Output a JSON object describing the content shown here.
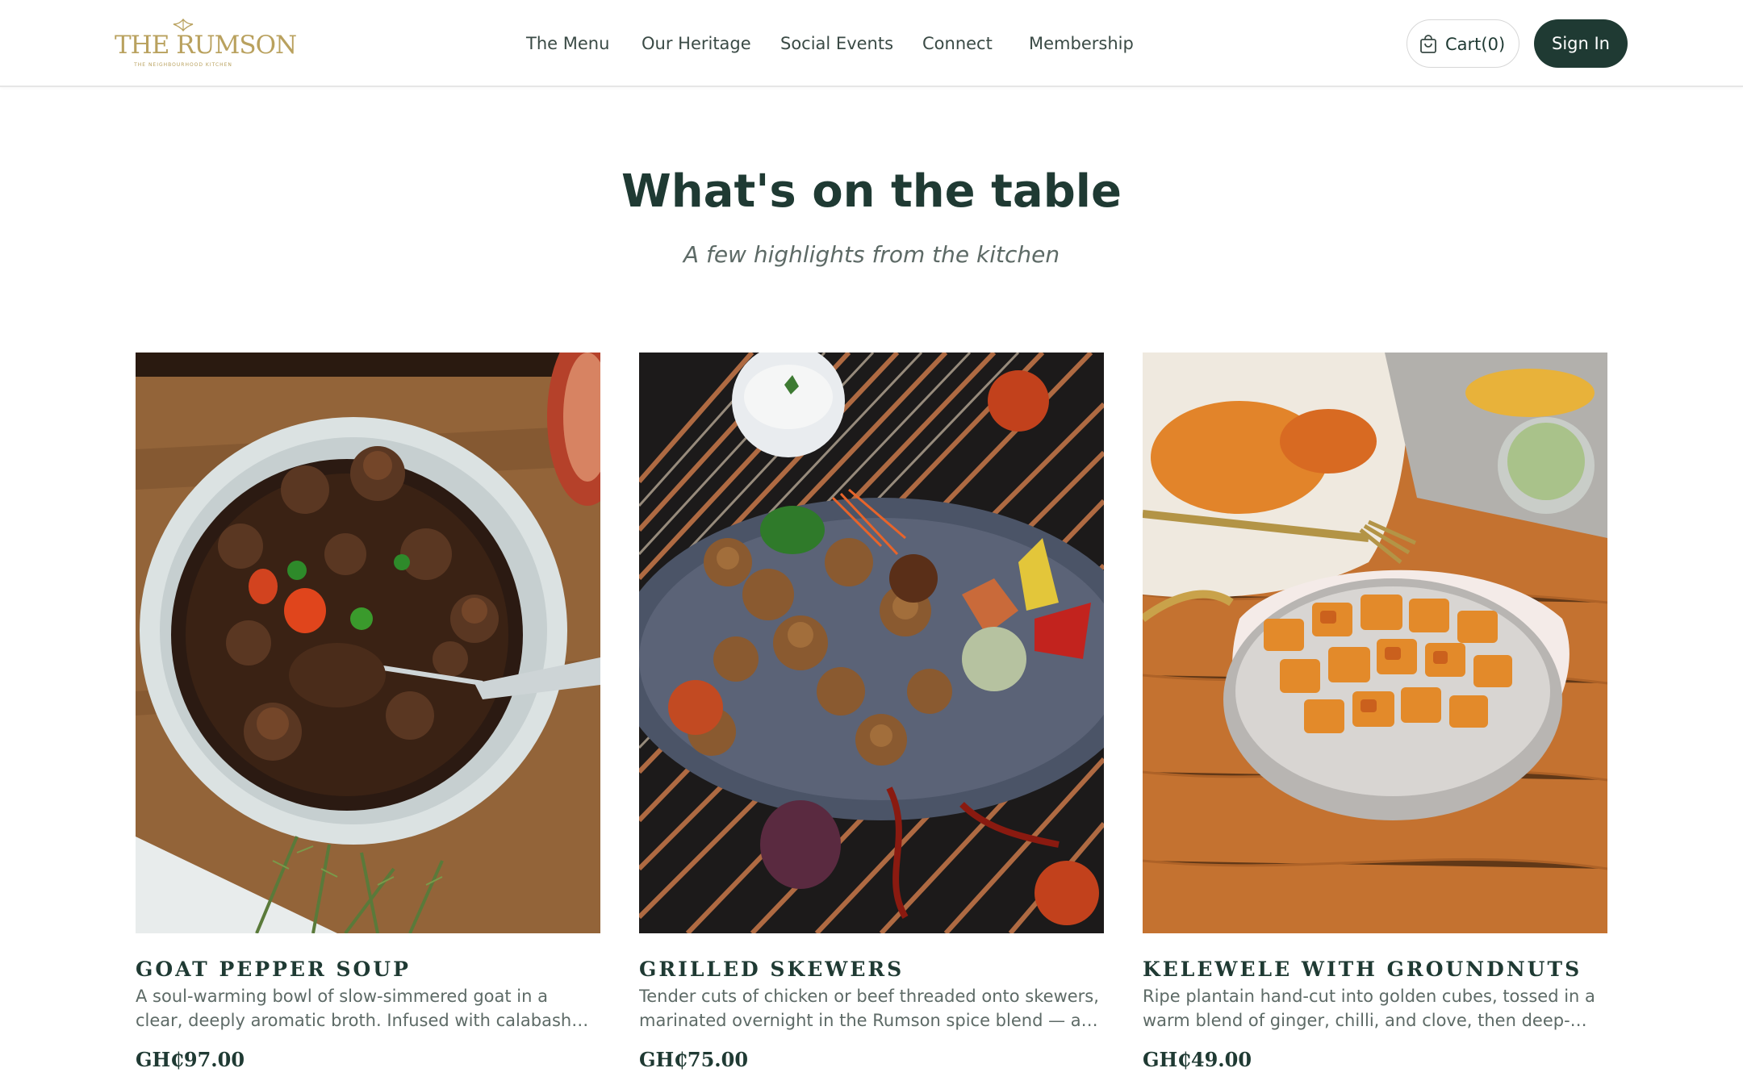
{
  "brand": {
    "name": "THE RUMSON",
    "tagline": "THE NEIGHBOURHOOD KITCHEN",
    "color": "#b9a15e"
  },
  "nav": {
    "items": [
      {
        "label": "The Menu"
      },
      {
        "label": "Our Heritage"
      },
      {
        "label": "Social Events"
      },
      {
        "label": "Connect"
      },
      {
        "label": "Membership"
      }
    ]
  },
  "header_actions": {
    "cart_label": "Cart(0)",
    "cart_icon": "shopping-bag-icon",
    "signin_label": "Sign In"
  },
  "section": {
    "title": "What's on the table",
    "subtitle": "A few highlights from the kitchen"
  },
  "dishes": [
    {
      "name": "GOAT PEPPER SOUP",
      "description": "A soul-warming bowl of slow-simmered goat in a clear, deeply aromatic broth. Infused with calabash nutmeg, uda and fresh herbs.",
      "price": "GH₵97.00"
    },
    {
      "name": "GRILLED SKEWERS",
      "description": "Tender cuts of chicken or beef threaded onto skewers, marinated overnight in the Rumson spice blend — a smoky, charred finish.",
      "price": "GH₵75.00"
    },
    {
      "name": "KELEWELE WITH GROUNDNUTS",
      "description": "Ripe plantain hand-cut into golden cubes, tossed in a warm blend of ginger, chilli, and clove, then deep-fried until caramelised.",
      "price": "GH₵49.00"
    }
  ],
  "colors": {
    "primary": "#1f3a33",
    "text_muted": "#5d6a66",
    "accent_gold": "#b9a15e"
  }
}
